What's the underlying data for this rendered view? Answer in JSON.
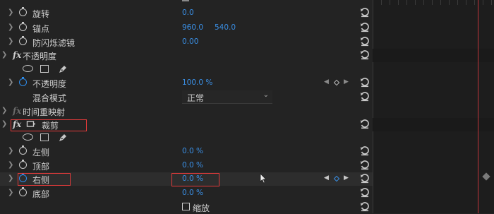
{
  "colors": {
    "accent": "#3a8fe5",
    "highlight": "#e03a3a",
    "panel": "#232323",
    "timeline": "#1d1d1d"
  },
  "rows": {
    "rotation": {
      "label": "旋转",
      "value": "0.0"
    },
    "anchor": {
      "label": "锚点",
      "value_x": "960.0",
      "value_y": "540.0"
    },
    "antiflicker": {
      "label": "防闪烁滤镜",
      "value": "0.00"
    },
    "opacity_fx": {
      "fx": "fx",
      "label": "不透明度"
    },
    "opacity": {
      "label": "不透明度",
      "value": "100.0 %"
    },
    "blend": {
      "label": "混合模式",
      "value": "正常"
    },
    "time_remap": {
      "fx": "fx",
      "label": "时间重映射"
    },
    "crop_fx": {
      "fx": "fx",
      "label": "裁剪"
    },
    "left": {
      "label": "左侧",
      "value": "0.0 %"
    },
    "top": {
      "label": "顶部",
      "value": "0.0 %"
    },
    "right": {
      "label": "右侧",
      "value": "0.0 %"
    },
    "bottom": {
      "label": "底部",
      "value": "0.0 %"
    },
    "zoom": {
      "label": "缩放"
    }
  },
  "icons": {
    "stopwatch": "stopwatch-icon",
    "reset": "reset-icon",
    "ellipse_mask": "ellipse-mask-icon",
    "rect_mask": "rectangle-mask-icon",
    "pen_mask": "pen-mask-icon",
    "crop": "crop-icon"
  }
}
